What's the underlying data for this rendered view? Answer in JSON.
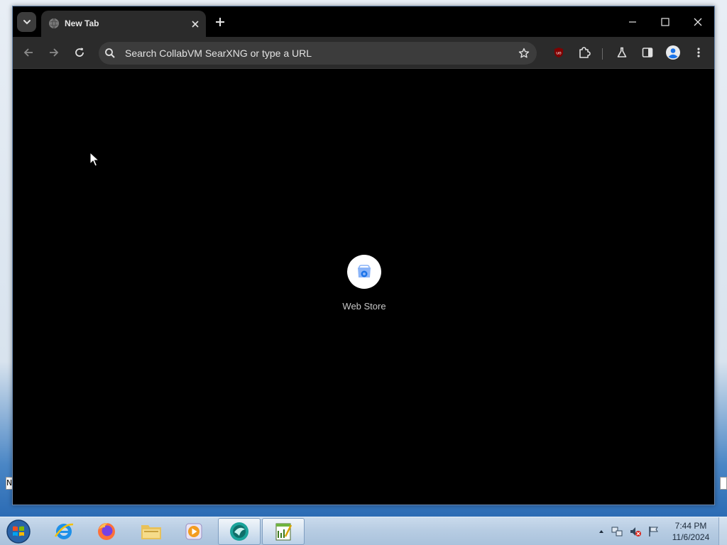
{
  "browser": {
    "tab": {
      "title": "New Tab"
    },
    "omnibox": {
      "placeholder": "Search CollabVM SearXNG or type a URL"
    },
    "accent": "#2b2b2b"
  },
  "ntp": {
    "shortcuts": [
      {
        "label": "Web Store"
      }
    ]
  },
  "desktop": {
    "sliver_text": "N"
  },
  "taskbar": {
    "apps": [
      "internet-explorer",
      "firefox",
      "file-explorer",
      "media-player",
      "collabvm-app",
      "notepad-chart-app"
    ],
    "clock": {
      "time": "7:44 PM",
      "date": "11/6/2024"
    }
  }
}
